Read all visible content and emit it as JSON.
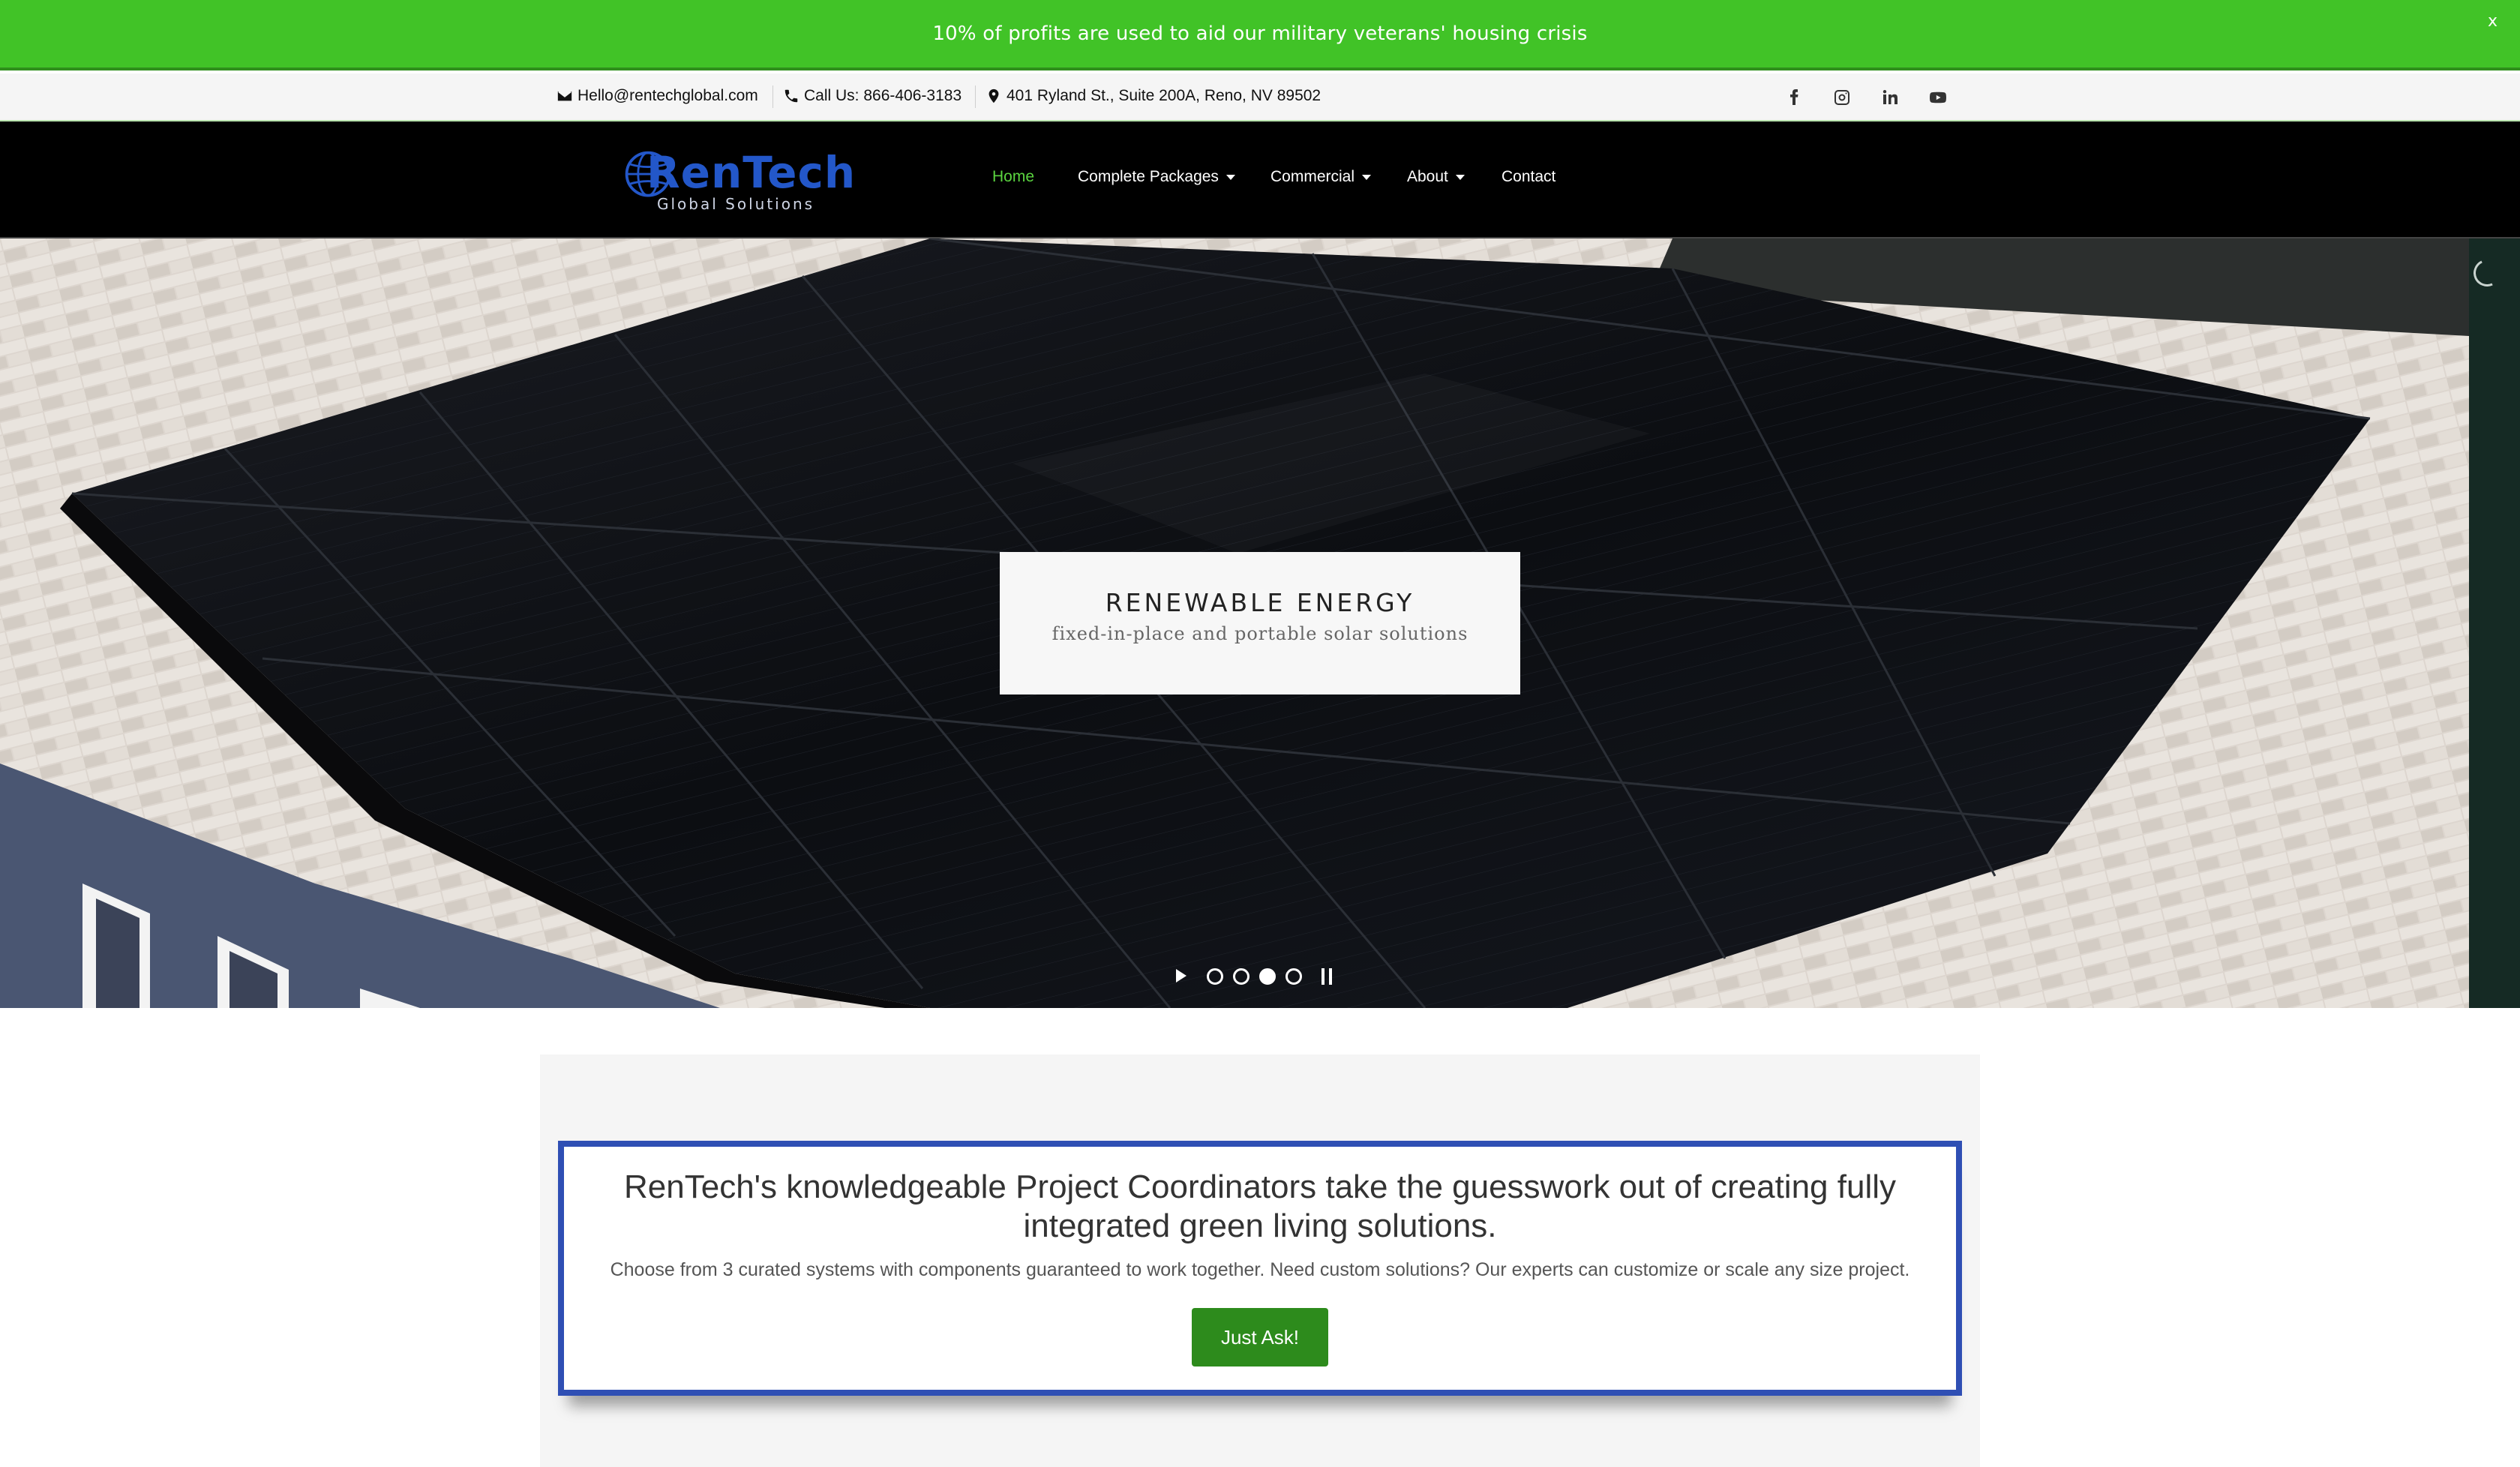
{
  "announcement": {
    "text": "10% of profits are used to aid our military veterans' housing crisis",
    "close_label": "x"
  },
  "topbar": {
    "email": "Hello@rentechglobal.com",
    "phone": "Call Us: 866-406-3183",
    "address": "401 Ryland St., Suite 200A, Reno, NV 89502",
    "social": [
      "facebook-icon",
      "instagram-icon",
      "linkedin-icon",
      "youtube-icon"
    ]
  },
  "logo": {
    "word": "RenTech",
    "sub": "Global Solutions"
  },
  "nav": {
    "items": [
      {
        "label": "Home",
        "active": true,
        "dropdown": false
      },
      {
        "label": "Complete Packages",
        "active": false,
        "dropdown": true
      },
      {
        "label": "Commercial",
        "active": false,
        "dropdown": true
      },
      {
        "label": "About",
        "active": false,
        "dropdown": true
      },
      {
        "label": "Contact",
        "active": false,
        "dropdown": false
      }
    ]
  },
  "hero": {
    "caption_title": "RENEWABLE ENERGY",
    "caption_sub": "fixed-in-place and portable solar solutions",
    "slide_count": 4,
    "active_slide": 3
  },
  "cta": {
    "heading": "RenTech's knowledgeable Project Coordinators take the guesswork out of creating fully integrated green living solutions.",
    "text": "Choose from 3 curated systems with components guaranteed to work together. Need custom solutions? Our experts can customize or scale any size project.",
    "button": "Just Ask!"
  },
  "colors": {
    "announce_green": "#41c327",
    "nav_active": "#5bd440",
    "cta_border": "#2f4fb4",
    "button_green": "#2d8b1c"
  }
}
